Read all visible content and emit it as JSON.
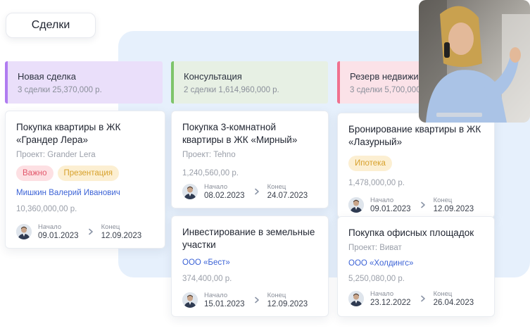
{
  "page": {
    "title": "Сделки"
  },
  "columns": [
    {
      "name": "Новая сделка",
      "meta": "3 сделки  25,370,000 р."
    },
    {
      "name": "Консультация",
      "meta": "2 сделки  1,614,960,000 р."
    },
    {
      "name": "Резерв недвижимости",
      "meta": "3 сделки  5,700,000 р."
    }
  ],
  "cards": {
    "c1": {
      "title": "Покупка квартиры в ЖК «Грандер Лера»",
      "project": "Проект: Grander Lera",
      "tags": [
        "Важно",
        "Презентация"
      ],
      "person": "Мишкин Валерий Иванович",
      "price": "10,360,000,00 р.",
      "start_label": "Начало",
      "start": "09.01.2023",
      "end_label": "Конец",
      "end": "12.09.2023"
    },
    "c2": {
      "title": "Покупка 3-комнатной квартиры в ЖК «Мирный»",
      "project": "Проект: Tehno",
      "price": "1,240,560,00 р.",
      "start_label": "Начало",
      "start": "08.02.2023",
      "end_label": "Конец",
      "end": "24.07.2023"
    },
    "c3": {
      "title": "Инвестирование в земельные участки",
      "company": "ООО «Бест»",
      "price": "374,400,00 р.",
      "start_label": "Начало",
      "start": "15.01.2023",
      "end_label": "Конец",
      "end": "12.09.2023"
    },
    "c4": {
      "title": "Бронирование квартиры в ЖК «Лазурный»",
      "tags": [
        "Ипотека"
      ],
      "price": "1,478,000,00 р.",
      "start_label": "Начало",
      "start": "09.01.2023",
      "end_label": "Конец",
      "end": "12.09.2023"
    },
    "c5": {
      "title": "Покупка офисных площадок",
      "project": "Проект: Виват",
      "company": "ООО «Холдингс»",
      "price": "5,250,080,00 р.",
      "start_label": "Начало",
      "start": "23.12.2022",
      "end_label": "Конец",
      "end": "26.04.2023"
    }
  }
}
